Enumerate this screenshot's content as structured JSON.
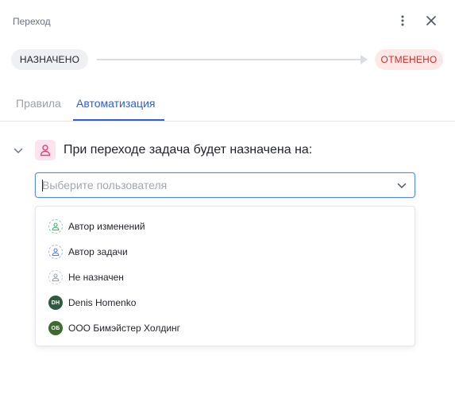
{
  "header": {
    "title": "Переход",
    "more_icon": "more-vertical-icon",
    "close_icon": "close-icon"
  },
  "transition": {
    "from_status": "НАЗНАЧЕНО",
    "to_status": "ОТМЕНЕНО",
    "to_status_color": "#d12c2c"
  },
  "tabs": [
    {
      "label": "Правила",
      "active": false
    },
    {
      "label": "Автоматизация",
      "active": true
    }
  ],
  "accent_color": "#2f5fd0",
  "rule": {
    "icon": "user-icon",
    "text": "При переходе задача будет назначена на:"
  },
  "user_select": {
    "placeholder": "Выберите пользователя",
    "value": "",
    "chevron_icon": "chevron-down-icon"
  },
  "options": [
    {
      "label": "Автор изменений",
      "icon": "user-icon",
      "icon_color": "#3bb46e"
    },
    {
      "label": "Автор задачи",
      "icon": "user-icon",
      "icon_color": "#5b7fdc"
    },
    {
      "label": "Не назначен",
      "icon": "user-icon",
      "icon_color": "#9aa1ab"
    },
    {
      "label": "Denis Homenko",
      "avatar_initials": "DH",
      "avatar_color": "#2f5a3e"
    },
    {
      "label": "ООО Бимэйстер Холдинг",
      "avatar_initials": "ОБ",
      "avatar_color": "#3d6b2c"
    }
  ]
}
